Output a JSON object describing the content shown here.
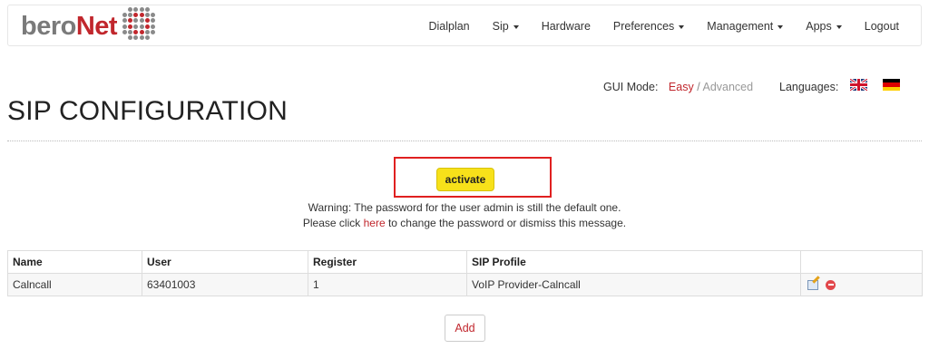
{
  "brand": {
    "part1": "bero",
    "part2": "Net"
  },
  "nav": [
    {
      "label": "Dialplan",
      "dropdown": false
    },
    {
      "label": "Sip",
      "dropdown": true
    },
    {
      "label": "Hardware",
      "dropdown": false
    },
    {
      "label": "Preferences",
      "dropdown": true
    },
    {
      "label": "Management",
      "dropdown": true
    },
    {
      "label": "Apps",
      "dropdown": true
    },
    {
      "label": "Logout",
      "dropdown": false
    }
  ],
  "gui_mode": {
    "label": "GUI Mode:",
    "easy": "Easy",
    "separator": "/",
    "advanced": "Advanced"
  },
  "languages": {
    "label": "Languages:",
    "flags": [
      "uk-flag-icon",
      "germany-flag-icon"
    ]
  },
  "page_title": "SIP CONFIGURATION",
  "activate": {
    "label": "activate"
  },
  "warning": {
    "line1": "Warning: The password for the user admin is still the default one.",
    "line2_prefix": "Please click ",
    "line2_link": "here",
    "line2_suffix": " to change the password or dismiss this message."
  },
  "table": {
    "headers": [
      "Name",
      "User",
      "Register",
      "SIP Profile",
      ""
    ],
    "rows": [
      {
        "name": "Calncall",
        "user": "63401003",
        "register": "1",
        "sip_profile": "VoIP Provider-Calncall",
        "actions": [
          "edit-icon",
          "delete-icon"
        ]
      }
    ]
  },
  "add_button": {
    "label": "Add"
  },
  "colors": {
    "brand_red": "#c1272d",
    "activate_yellow": "#f7e11a",
    "highlight_border": "#e02020"
  }
}
